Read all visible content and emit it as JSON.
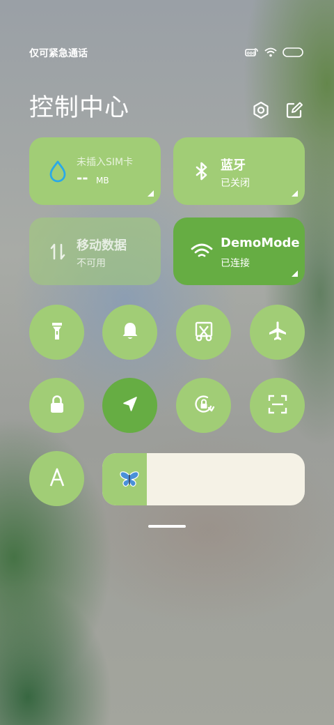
{
  "status_bar": {
    "carrier": "仅可紧急通话",
    "icons": [
      "nfc-icon",
      "wifi-icon",
      "battery-icon"
    ]
  },
  "header": {
    "title": "控制中心",
    "actions": [
      "settings-icon",
      "edit-icon"
    ]
  },
  "cards": {
    "sim": {
      "label": "未插入SIM卡",
      "value": "--",
      "unit": "MB",
      "icon": "water-drop-icon",
      "icon_color": "#2aa9e8"
    },
    "bluetooth": {
      "title": "蓝牙",
      "status": "已关闭",
      "icon": "bluetooth-icon"
    },
    "mobile_data": {
      "title": "移动数据",
      "status": "不可用",
      "icon": "data-arrows-icon"
    },
    "wifi": {
      "title": "DemoMode",
      "status": "已连接",
      "icon": "wifi-icon"
    }
  },
  "tiles": [
    {
      "name": "flashlight",
      "icon": "flashlight-icon",
      "active": false
    },
    {
      "name": "ringer",
      "icon": "bell-icon",
      "active": false
    },
    {
      "name": "screenshot",
      "icon": "scissors-icon",
      "active": false
    },
    {
      "name": "airplane-mode",
      "icon": "airplane-icon",
      "active": false
    },
    {
      "name": "lock-screen",
      "icon": "lock-icon",
      "active": false
    },
    {
      "name": "location",
      "icon": "location-arrow-icon",
      "active": true
    },
    {
      "name": "auto-rotate",
      "icon": "rotation-lock-icon",
      "active": false
    },
    {
      "name": "scanner",
      "icon": "scan-icon",
      "active": false
    },
    {
      "name": "auto-font",
      "icon": "font-a-icon",
      "active": false
    }
  ],
  "brightness": {
    "level": 0.22,
    "icon": "butterfly-icon"
  },
  "colors": {
    "tile_green": "#a1cd76",
    "tile_active_green": "#66ad43",
    "slider_track": "#f5f2e6"
  }
}
